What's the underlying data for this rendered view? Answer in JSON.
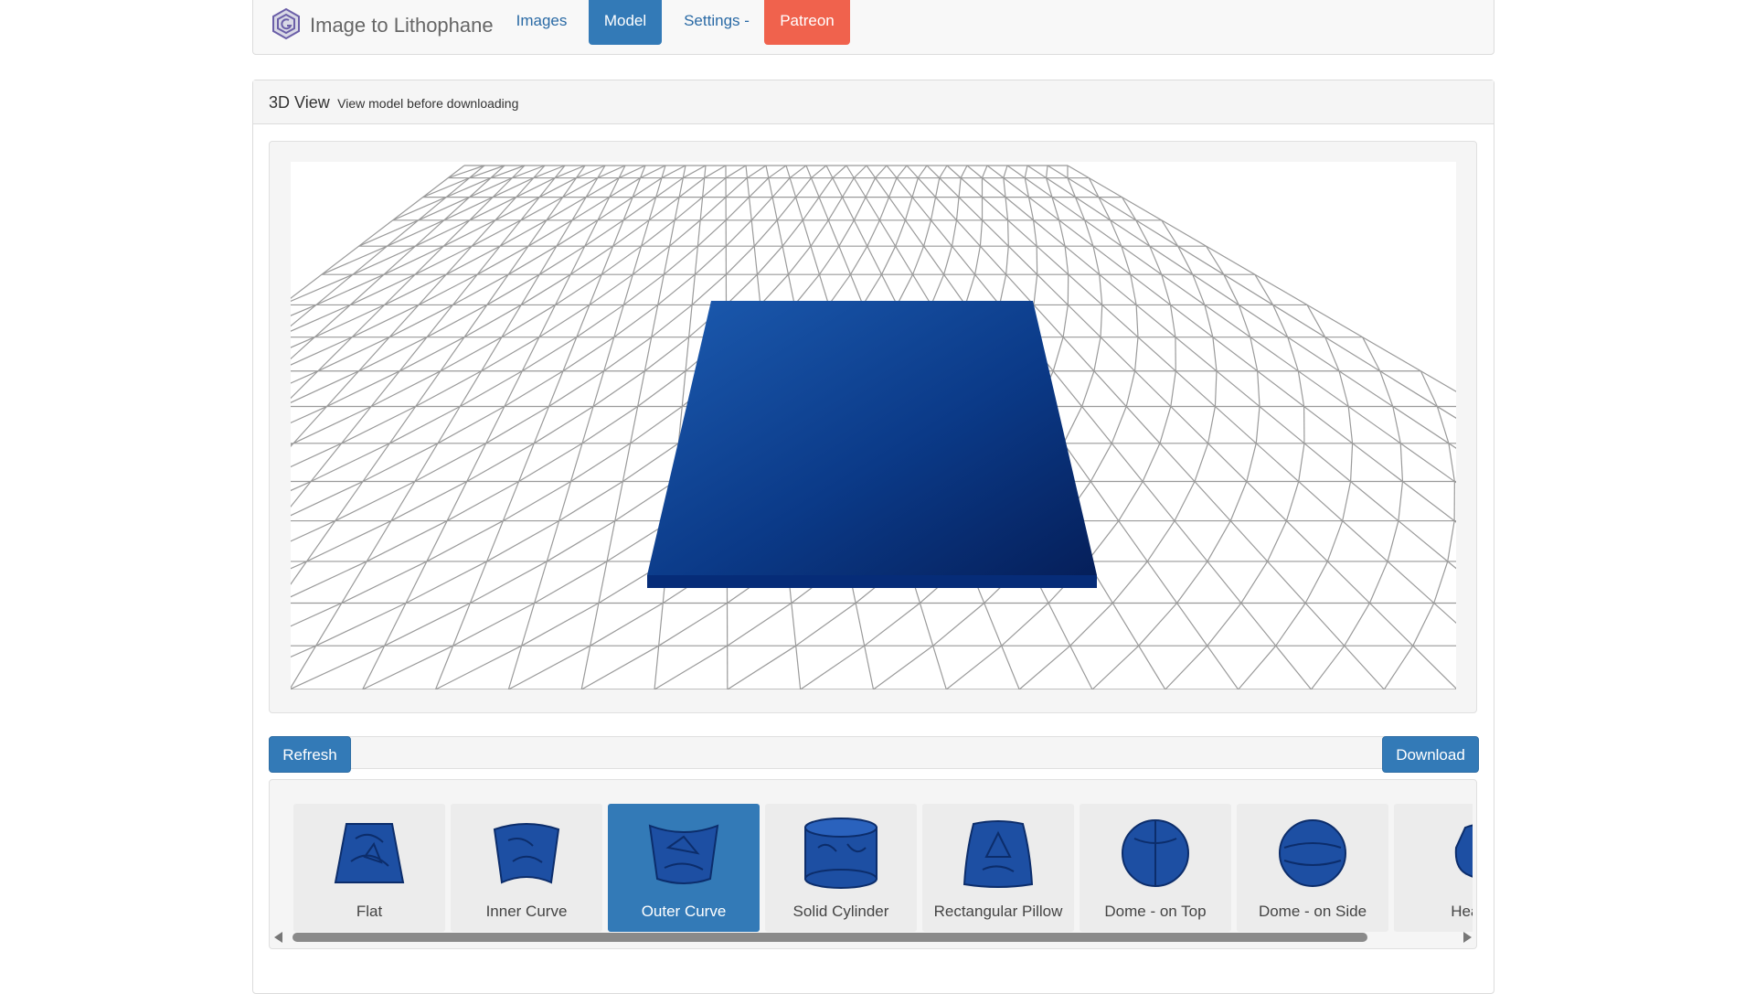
{
  "nav": {
    "brand": "Image to Lithophane",
    "brand_icon": "hexagon-logo-icon",
    "items": [
      {
        "label": "Images"
      },
      {
        "label": "Model"
      },
      {
        "label": "Settings -"
      },
      {
        "label": "Patreon"
      }
    ],
    "active": "Model",
    "colors": {
      "active": "#337ab7",
      "patreon": "#f0624d",
      "link": "#2a6aa5"
    }
  },
  "panel": {
    "title": "3D View",
    "subtitle": "View model before downloading"
  },
  "viewer": {
    "model_color": "#0b3c8a",
    "grid_color": "#9a9a9a"
  },
  "toolbar": {
    "refresh_label": "Refresh",
    "download_label": "Download"
  },
  "shapes": {
    "items": [
      {
        "label": "Flat",
        "icon": "flat-shape-icon"
      },
      {
        "label": "Inner Curve",
        "icon": "inner-curve-icon"
      },
      {
        "label": "Outer Curve",
        "icon": "outer-curve-icon"
      },
      {
        "label": "Solid Cylinder",
        "icon": "cylinder-icon"
      },
      {
        "label": "Rectangular Pillow",
        "icon": "pillow-icon"
      },
      {
        "label": "Dome - on Top",
        "icon": "dome-top-icon"
      },
      {
        "label": "Dome - on Side",
        "icon": "dome-side-icon"
      },
      {
        "label": "Heart",
        "icon": "heart-shape-icon"
      }
    ],
    "selected": "Outer Curve"
  }
}
